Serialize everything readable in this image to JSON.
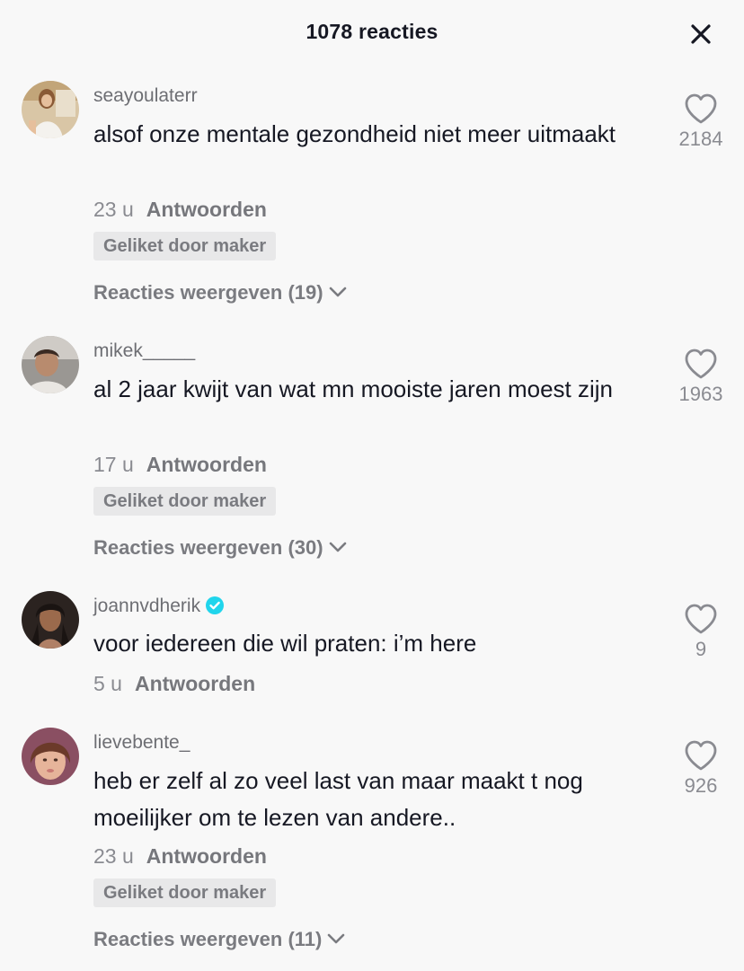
{
  "header": {
    "title": "1078 reacties"
  },
  "icons": {
    "close": "close-icon",
    "like": "heart-outline-icon",
    "verified": "verified-check-icon",
    "expand": "chevron-down-icon"
  },
  "colors": {
    "background": "#f8f8f8",
    "text_primary": "#161823",
    "text_secondary": "#8a8b91",
    "badge_bg": "#e8e8e9",
    "verified": "#20d5ec"
  },
  "comments": [
    {
      "username": "seayoulaterr",
      "verified": false,
      "text": "alsof onze mentale gezondheid niet meer uitmaakt",
      "time": "23 u",
      "reply_label": "Antwoorden",
      "badge": "Geliket door maker",
      "view_replies": "Reacties weergeven (19)",
      "likes": "2184"
    },
    {
      "username": "mikek_____",
      "verified": false,
      "text": "al 2 jaar kwijt van wat mn mooiste jaren moest zijn",
      "time": "17 u",
      "reply_label": "Antwoorden",
      "badge": "Geliket door maker",
      "view_replies": "Reacties weergeven (30)",
      "likes": "1963"
    },
    {
      "username": "joannvdherik",
      "verified": true,
      "text": "voor iedereen die wil praten: i’m here",
      "time": "5 u",
      "reply_label": "Antwoorden",
      "likes": "9"
    },
    {
      "username": "lievebente_",
      "verified": false,
      "text": "heb er zelf al zo veel last van maar maakt t nog moeilijker om te lezen van andere..",
      "time": "23 u",
      "reply_label": "Antwoorden",
      "badge": "Geliket door maker",
      "view_replies": "Reacties weergeven (11)",
      "likes": "926"
    }
  ]
}
